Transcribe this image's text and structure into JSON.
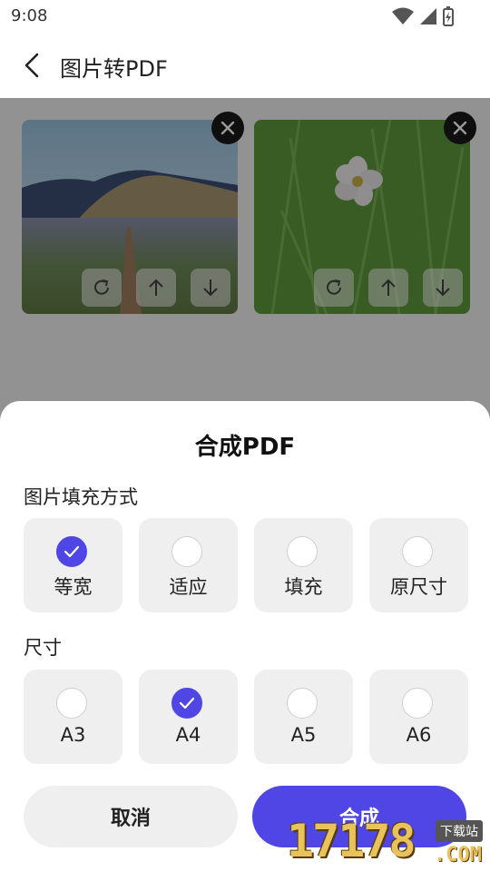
{
  "status": {
    "time": "9:08"
  },
  "header": {
    "title": "图片转PDF"
  },
  "sheet": {
    "title": "合成PDF",
    "fill_mode": {
      "label": "图片填充方式",
      "options": [
        {
          "label": "等宽",
          "checked": true
        },
        {
          "label": "适应",
          "checked": false
        },
        {
          "label": "填充",
          "checked": false
        },
        {
          "label": "原尺寸",
          "checked": false
        }
      ]
    },
    "size": {
      "label": "尺寸",
      "options": [
        {
          "label": "A3",
          "checked": false
        },
        {
          "label": "A4",
          "checked": true
        },
        {
          "label": "A5",
          "checked": false
        },
        {
          "label": "A6",
          "checked": false
        }
      ]
    },
    "cancel_label": "取消",
    "confirm_label": "合成"
  },
  "watermark": {
    "text": "17178",
    "tag": "下载站",
    "suffix": ".COM"
  },
  "colors": {
    "accent": "#4f46e5",
    "option_bg": "#efefef"
  }
}
